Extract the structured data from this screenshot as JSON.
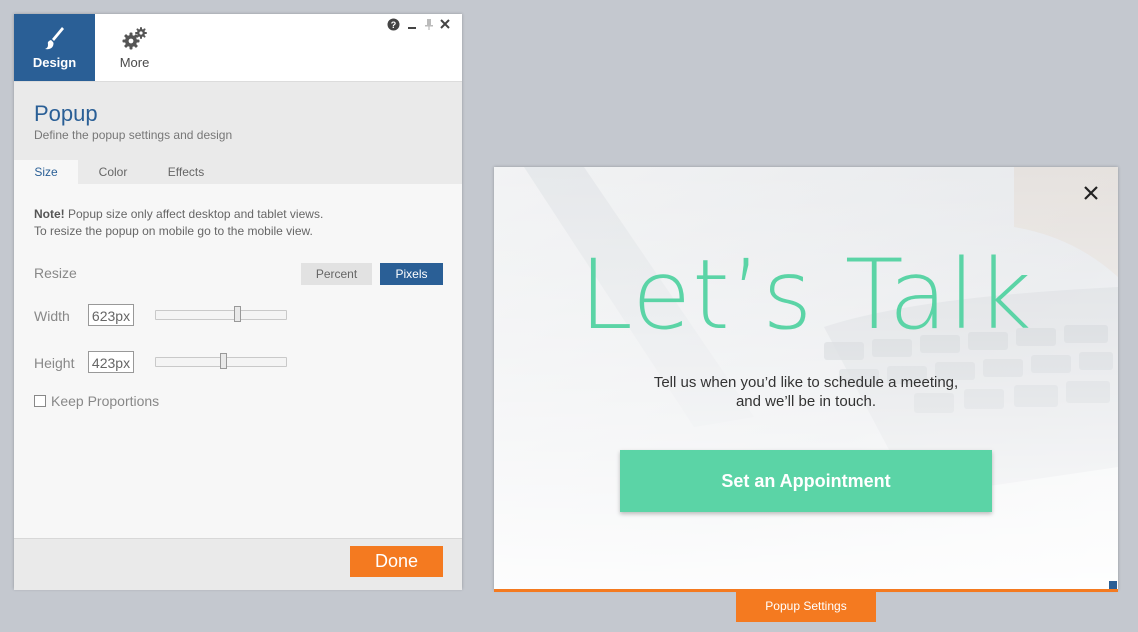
{
  "panel": {
    "tabs": [
      {
        "label": "Design",
        "icon": "brush-icon",
        "active": true
      },
      {
        "label": "More",
        "icon": "gears-icon",
        "active": false
      }
    ],
    "window_buttons": {
      "help": "?",
      "minimize": "‒",
      "pin": "⊥",
      "close": "✕"
    },
    "title": "Popup",
    "subtitle": "Define the popup settings and design",
    "subtabs": [
      {
        "label": "Size",
        "active": true
      },
      {
        "label": "Color",
        "active": false
      },
      {
        "label": "Effects",
        "active": false
      }
    ],
    "note": {
      "bold": "Note!",
      "line1": " Popup size only affect desktop and tablet views.",
      "line2": "To resize the popup on mobile go to the mobile view."
    },
    "resize": {
      "label": "Resize",
      "percent_label": "Percent",
      "pixels_label": "Pixels",
      "selected": "Pixels"
    },
    "width": {
      "label": "Width",
      "value": "623px"
    },
    "height": {
      "label": "Height",
      "value": "423px"
    },
    "keep_proportions": {
      "label": "Keep Proportions",
      "checked": false
    },
    "done_label": "Done"
  },
  "preview": {
    "headline": "Let’s Talk",
    "tagline_line1": "Tell us when you’d like to schedule a meeting,",
    "tagline_line2": "and we’ll be in touch.",
    "cta_label": "Set an Appointment",
    "close_symbol": "✕"
  },
  "popup_settings_tab": "Popup Settings",
  "colors": {
    "brand_blue": "#2a5f96",
    "accent_orange": "#f47a20",
    "cta_green": "#5bd4a6"
  }
}
